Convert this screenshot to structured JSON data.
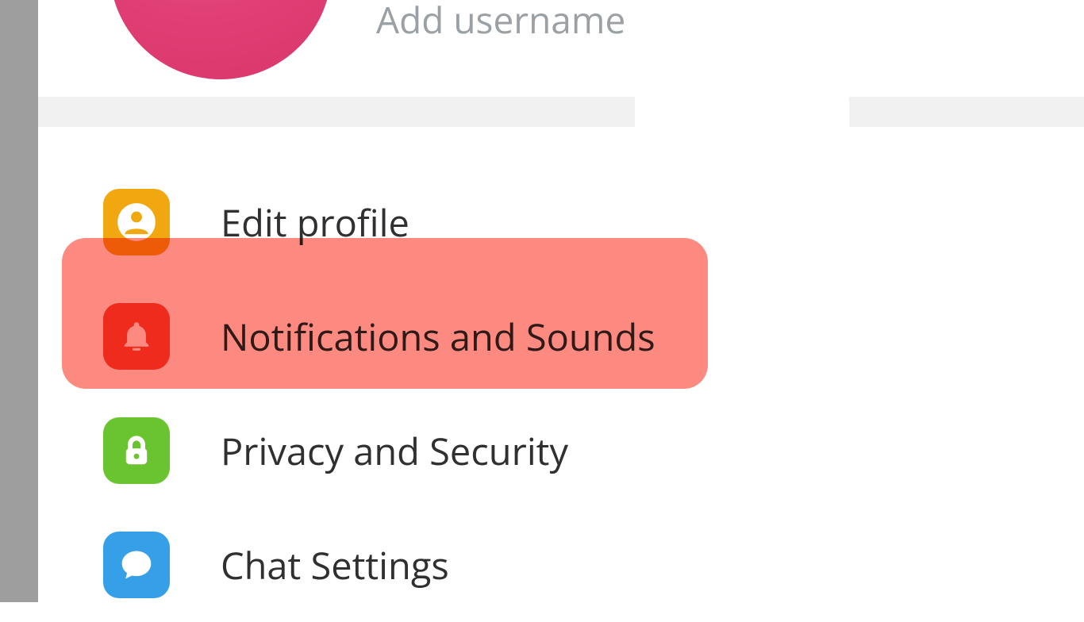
{
  "profile": {
    "add_username_label": "Add username"
  },
  "menu": {
    "items": [
      {
        "label": "Edit profile",
        "icon": "person-icon",
        "color": "orange"
      },
      {
        "label": "Notifications and Sounds",
        "icon": "bell-icon",
        "color": "red"
      },
      {
        "label": "Privacy and Security",
        "icon": "lock-icon",
        "color": "green"
      },
      {
        "label": "Chat Settings",
        "icon": "chat-icon",
        "color": "blue"
      }
    ],
    "highlighted_index": 1
  },
  "colors": {
    "highlight": "#fc8a80",
    "avatar_gradient_start": "#ed5e8e",
    "avatar_gradient_end": "#d9366a"
  }
}
